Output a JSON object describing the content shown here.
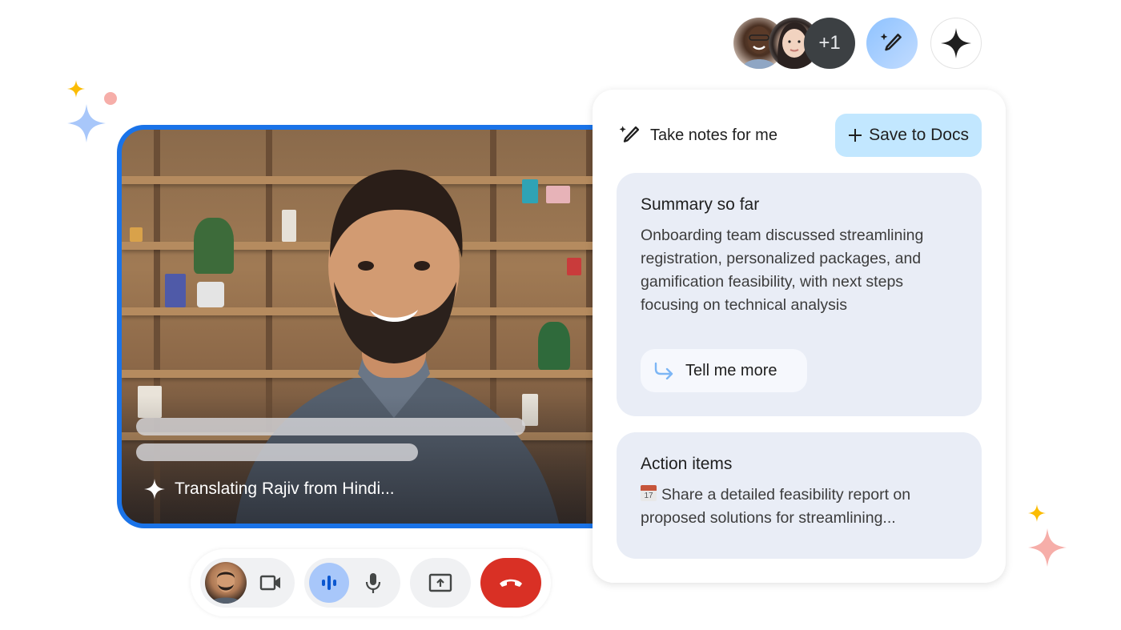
{
  "header": {
    "participants": [
      {
        "name": "participant-1"
      },
      {
        "name": "participant-2"
      }
    ],
    "overflow_count": "+1"
  },
  "video": {
    "caption_status": "Translating Rajiv from Hindi...",
    "speaker": "Rajiv"
  },
  "notes_panel": {
    "title": "Take notes for me",
    "save_button": "Save to Docs",
    "summary": {
      "heading": "Summary so far",
      "body": "Onboarding team discussed streamlining registration, personalized packages, and gamification feasibility, with next steps focusing on technical analysis",
      "more_button": "Tell me more"
    },
    "action_items": {
      "heading": "Action items",
      "calendar_day": "17",
      "items": [
        "Share a detailed feasibility report on proposed solutions for streamlining..."
      ]
    }
  },
  "controls": {
    "camera": "camera-on",
    "audio_level": "speaking",
    "mic": "mic-on",
    "present": "present-screen",
    "end_call": "leave-call"
  },
  "colors": {
    "accent_blue": "#1a73e8",
    "save_button_bg": "#c2e7ff",
    "card_bg": "#e9edf6",
    "end_call_red": "#d93025",
    "sparkle_yellow": "#fbbc04",
    "sparkle_blue": "#a8c7fa",
    "sparkle_pink": "#f6aea9"
  }
}
